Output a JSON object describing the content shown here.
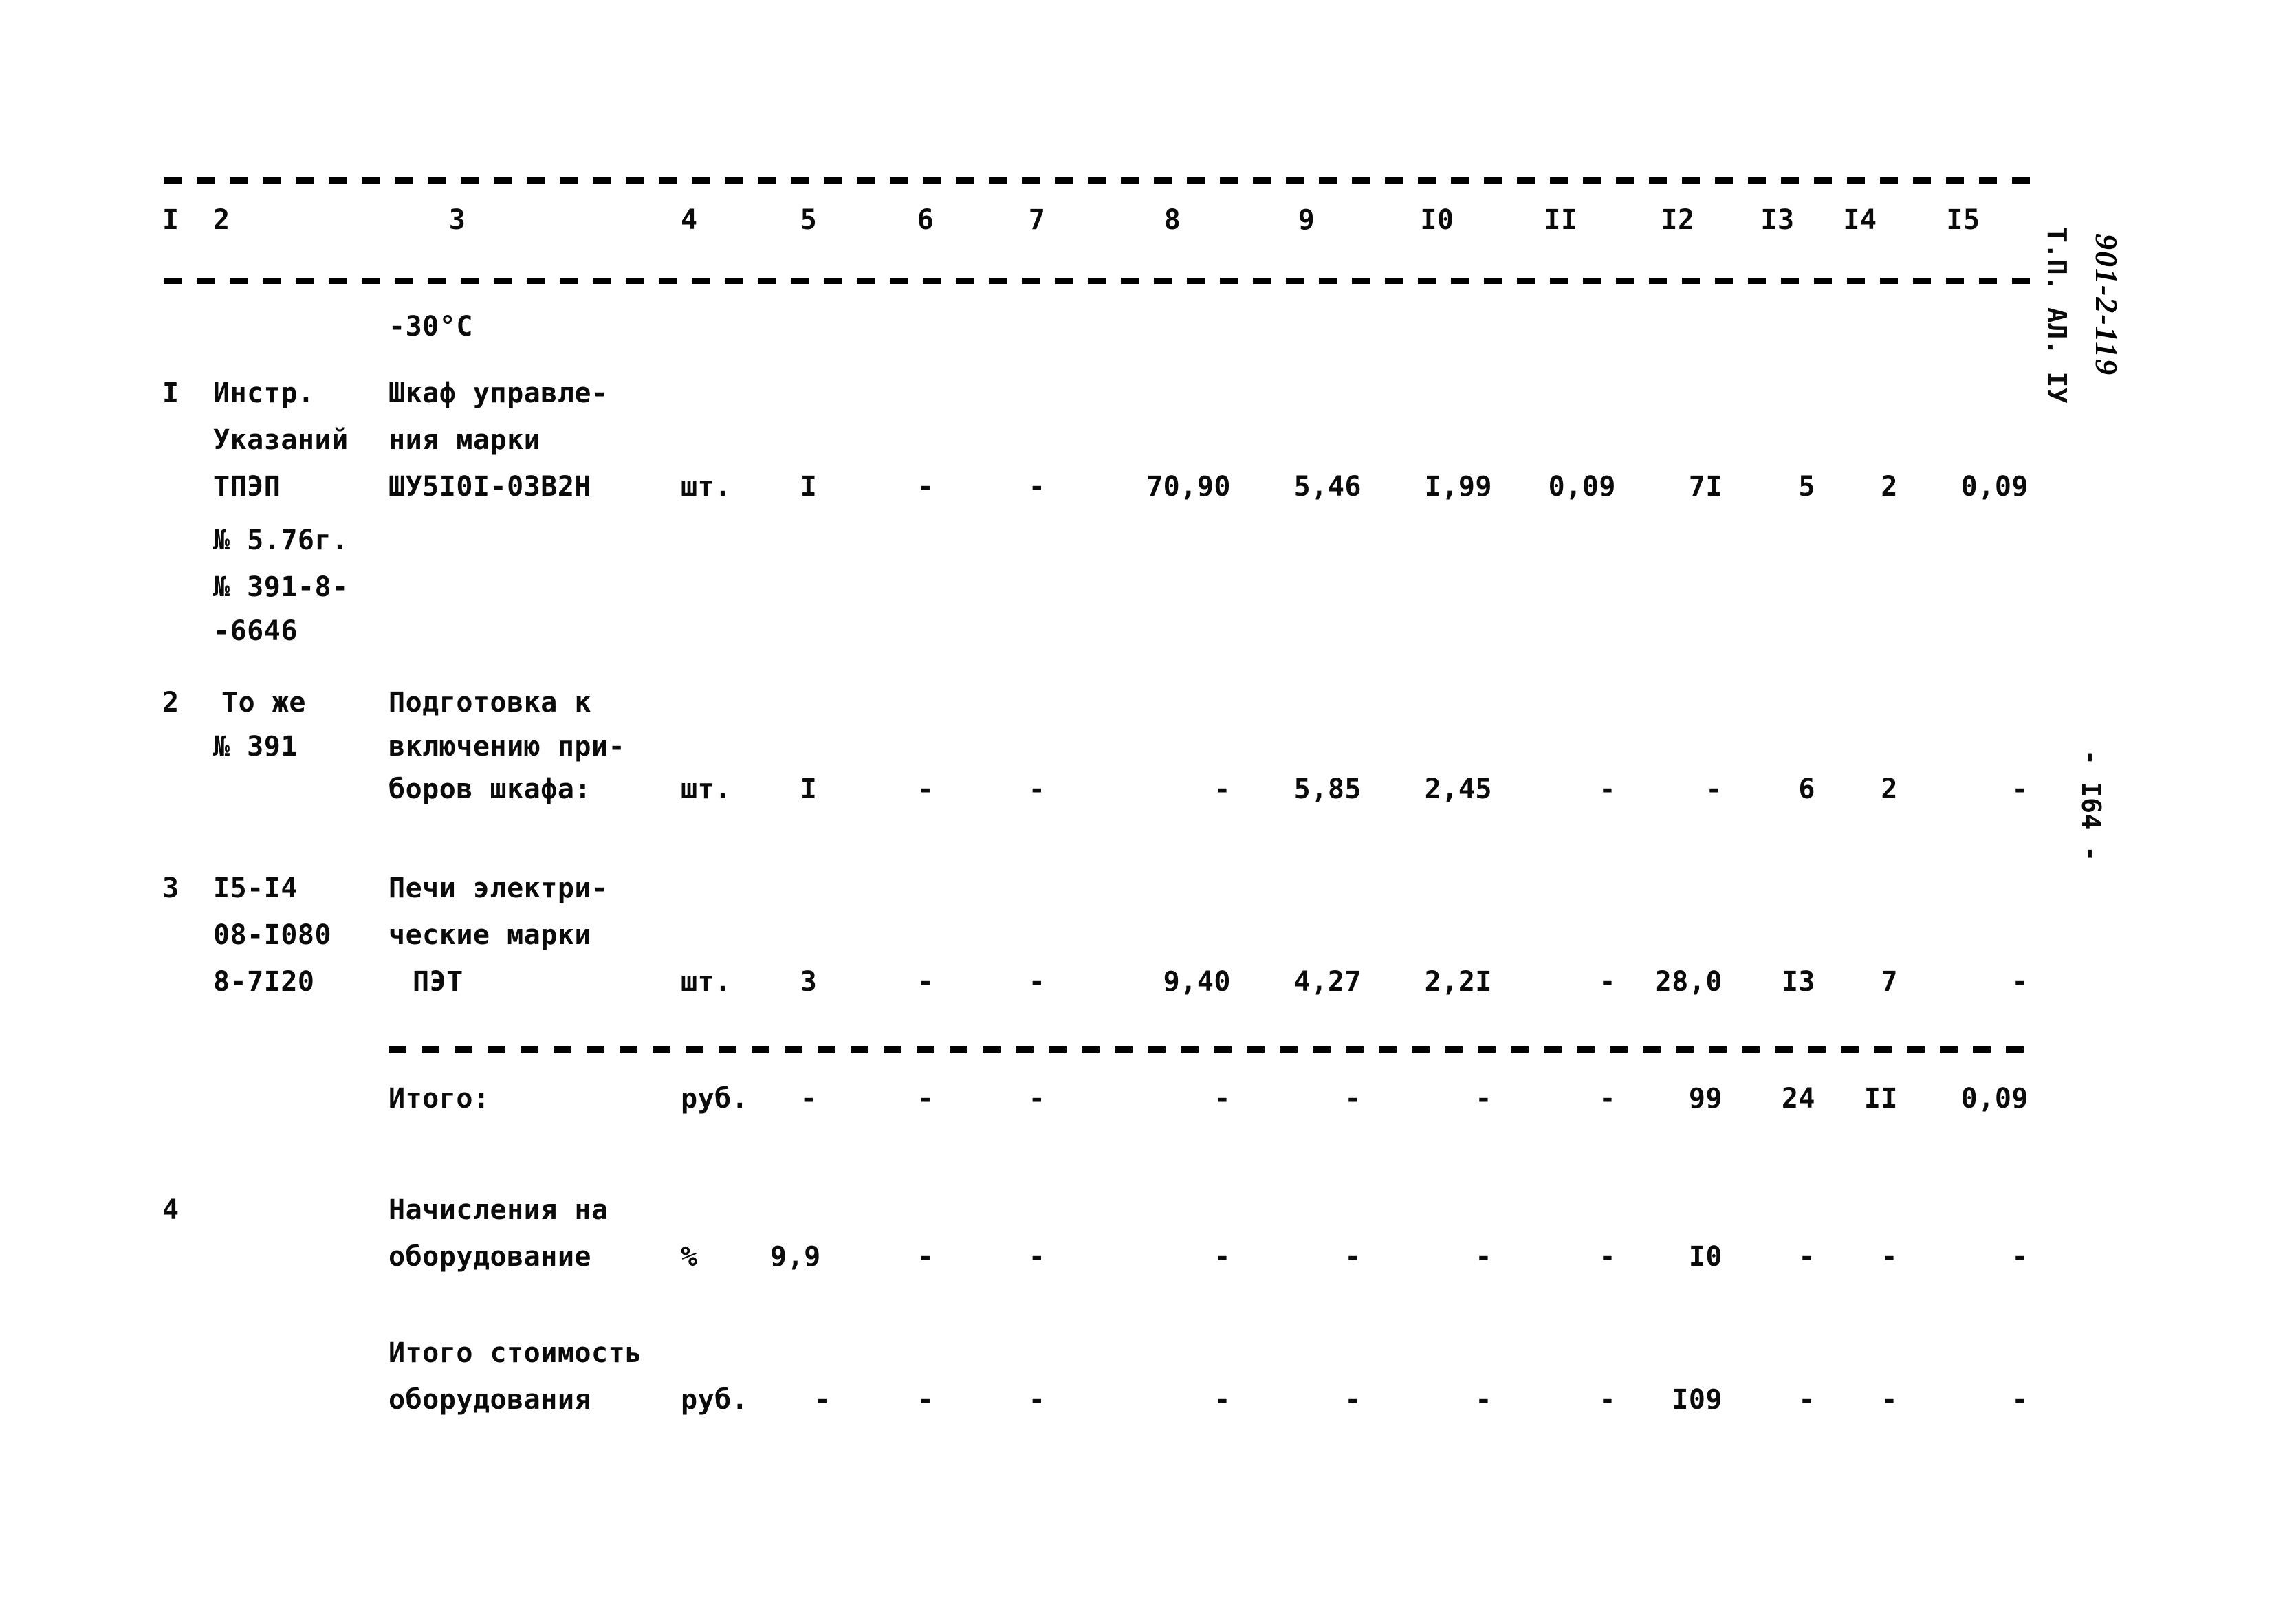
{
  "document": {
    "kind": "scanned-estimate-table",
    "page_number": "- I64 -",
    "side_stamp": "Т.П. АЛ. IУ",
    "side_handwritten_mark": "901-2-119"
  },
  "table": {
    "column_headers": [
      "I",
      "2",
      "3",
      "4",
      "5",
      "6",
      "7",
      "8",
      "9",
      "I0",
      "II",
      "I2",
      "I3",
      "I4",
      "I5"
    ],
    "carryover_note": "-30°C",
    "rows": [
      {
        "no": "I",
        "ref_lines": [
          "Инстр.",
          "Указаний",
          "ТПЭП",
          "№ 5.76г.",
          "№ 391-8-",
          "-6646"
        ],
        "name_lines": [
          "Шкаф управле-",
          "ния марки",
          "ШУ5I0I-03В2Н"
        ],
        "unit": "шт.",
        "qty": "I",
        "c6": "-",
        "c7": "-",
        "c8": "70,90",
        "c9": "5,46",
        "c10": "I,99",
        "c11": "0,09",
        "c12": "7I",
        "c13": "5",
        "c14": "2",
        "c15": "0,09"
      },
      {
        "no": "2",
        "ref_lines": [
          "То же",
          "№ 391"
        ],
        "name_lines": [
          "Подготовка к",
          "включению при-",
          "боров шкафа:"
        ],
        "unit": "шт.",
        "qty": "I",
        "c6": "-",
        "c7": "-",
        "c8": "-",
        "c9": "5,85",
        "c10": "2,45",
        "c11": "-",
        "c12": "-",
        "c13": "6",
        "c14": "2",
        "c15": "-"
      },
      {
        "no": "3",
        "ref_lines": [
          "I5-I4",
          "08-I080",
          "8-7I20"
        ],
        "name_lines": [
          "Печи электри-",
          "ческие марки",
          "ПЭТ"
        ],
        "unit": "шт.",
        "qty": "3",
        "c6": "-",
        "c7": "-",
        "c8": "9,40",
        "c9": "4,27",
        "c10": "2,2I",
        "c11": "-",
        "c12": "28,0",
        "c13": "I3",
        "c14": "7",
        "c15": "-"
      }
    ],
    "subtotal": {
      "label": "Итого:",
      "unit": "руб.",
      "c5": "-",
      "c6": "-",
      "c7": "-",
      "c8": "-",
      "c9": "-",
      "c10": "-",
      "c11": "-",
      "c12": "99",
      "c13": "24",
      "c14": "II",
      "c15": "0,09"
    },
    "surcharge": {
      "no": "4",
      "name_lines": [
        "Начисления на",
        "оборудование"
      ],
      "unit": "%",
      "qty": "9,9",
      "c6": "-",
      "c7": "-",
      "c8": "-",
      "c9": "-",
      "c10": "-",
      "c11": "-",
      "c12": "I0",
      "c13": "-",
      "c14": "-",
      "c15": "-"
    },
    "grand_total": {
      "name_lines": [
        "Итого стоимость",
        "оборудования"
      ],
      "unit": "руб.",
      "c5": "-",
      "c6": "-",
      "c7": "-",
      "c8": "-",
      "c9": "-",
      "c10": "-",
      "c11": "-",
      "c12": "I09",
      "c13": "-",
      "c14": "-",
      "c15": "-"
    }
  }
}
